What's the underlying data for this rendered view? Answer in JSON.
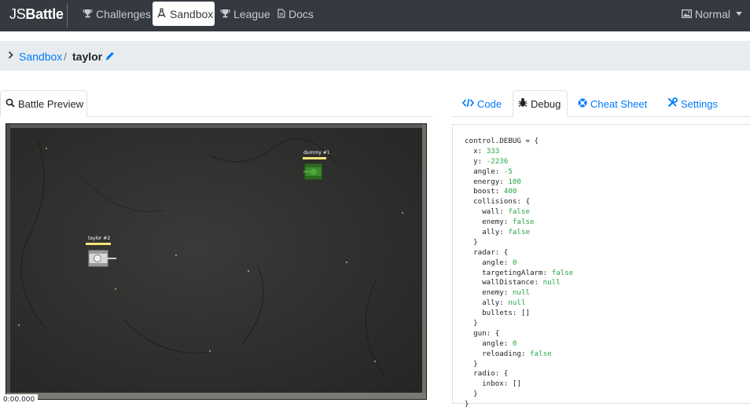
{
  "brand": {
    "light": "JS",
    "bold": "Battle"
  },
  "nav": {
    "challenges": "Challenges",
    "sandbox": "Sandbox",
    "league": "League",
    "docs": "Docs",
    "quality": "Normal"
  },
  "breadcrumb": {
    "parent": "Sandbox",
    "separator": "/",
    "current": "taylor"
  },
  "left_tabs": {
    "preview": "Battle Preview"
  },
  "arena": {
    "tanks": [
      {
        "label": "dummy #1",
        "color": "#3d8b2e"
      },
      {
        "label": "taylor #2",
        "color": "#d9d9d9"
      }
    ],
    "timer": "0:00.000"
  },
  "right_tabs": {
    "code": "Code",
    "debug": "Debug",
    "cheat_sheet": "Cheat Sheet",
    "settings": "Settings"
  },
  "debug": {
    "lines": [
      {
        "indent": "",
        "key": "control.DEBUG = {",
        "val": ""
      },
      {
        "indent": "  ",
        "key": "x: ",
        "val": "333"
      },
      {
        "indent": "  ",
        "key": "y: ",
        "val": "-2236"
      },
      {
        "indent": "  ",
        "key": "angle: ",
        "val": "-5"
      },
      {
        "indent": "  ",
        "key": "energy: ",
        "val": "100"
      },
      {
        "indent": "  ",
        "key": "boost: ",
        "val": "400"
      },
      {
        "indent": "  ",
        "key": "collisions: {",
        "val": ""
      },
      {
        "indent": "    ",
        "key": "wall: ",
        "val": "false"
      },
      {
        "indent": "    ",
        "key": "enemy: ",
        "val": "false"
      },
      {
        "indent": "    ",
        "key": "ally: ",
        "val": "false"
      },
      {
        "indent": "  ",
        "key": "}",
        "val": ""
      },
      {
        "indent": "  ",
        "key": "radar: {",
        "val": ""
      },
      {
        "indent": "    ",
        "key": "angle: ",
        "val": "0"
      },
      {
        "indent": "    ",
        "key": "targetingAlarm: ",
        "val": "false"
      },
      {
        "indent": "    ",
        "key": "wallDistance: ",
        "val": "null"
      },
      {
        "indent": "    ",
        "key": "enemy: ",
        "val": "null"
      },
      {
        "indent": "    ",
        "key": "ally: ",
        "val": "null"
      },
      {
        "indent": "    ",
        "key": "bullets: []",
        "val": ""
      },
      {
        "indent": "  ",
        "key": "}",
        "val": ""
      },
      {
        "indent": "  ",
        "key": "gun: {",
        "val": ""
      },
      {
        "indent": "    ",
        "key": "angle: ",
        "val": "0"
      },
      {
        "indent": "    ",
        "key": "reloading: ",
        "val": "false"
      },
      {
        "indent": "  ",
        "key": "}",
        "val": ""
      },
      {
        "indent": "  ",
        "key": "radio: {",
        "val": ""
      },
      {
        "indent": "    ",
        "key": "inbox: []",
        "val": ""
      },
      {
        "indent": "  ",
        "key": "}",
        "val": ""
      },
      {
        "indent": "",
        "key": "}",
        "val": ""
      }
    ]
  },
  "colors": {
    "navbar": "#343a40",
    "link": "#007bff",
    "value": "#28a745",
    "crumb_bg": "#e9ecef"
  }
}
